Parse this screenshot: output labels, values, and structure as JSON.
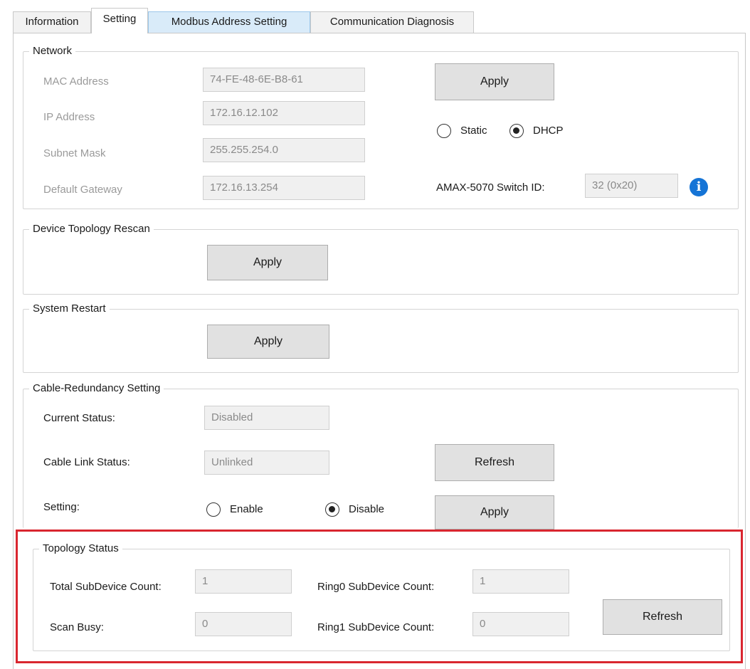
{
  "tabs": [
    {
      "label": "Information"
    },
    {
      "label": "Setting"
    },
    {
      "label": "Modbus Address Setting"
    },
    {
      "label": "Communication Diagnosis"
    }
  ],
  "network": {
    "title": "Network",
    "mac_label": "MAC Address",
    "mac_value": "74-FE-48-6E-B8-61",
    "ip_label": "IP Address",
    "ip_value": "172.16.12.102",
    "subnet_label": "Subnet Mask",
    "subnet_value": "255.255.254.0",
    "gateway_label": "Default Gateway",
    "gateway_value": "172.16.13.254",
    "apply_label": "Apply",
    "static_label": "Static",
    "dhcp_label": "DHCP",
    "mode_selected": "DHCP",
    "switch_id_label": "AMAX-5070 Switch ID:",
    "switch_id_value": "32 (0x20)",
    "info_glyph": "i"
  },
  "rescan": {
    "title": "Device Topology Rescan",
    "apply_label": "Apply"
  },
  "restart": {
    "title": "System Restart",
    "apply_label": "Apply"
  },
  "cable": {
    "title": "Cable-Redundancy Setting",
    "current_status_label": "Current Status:",
    "current_status_value": "Disabled",
    "link_status_label": "Cable Link Status:",
    "link_status_value": "Unlinked",
    "refresh_label": "Refresh",
    "setting_label": "Setting:",
    "enable_label": "Enable",
    "disable_label": "Disable",
    "setting_selected": "Disable",
    "apply_label": "Apply"
  },
  "topology": {
    "title": "Topology Status",
    "total_label": "Total SubDevice Count:",
    "total_value": "1",
    "ring0_label": "Ring0 SubDevice Count:",
    "ring0_value": "1",
    "scan_busy_label": "Scan Busy:",
    "scan_busy_value": "0",
    "ring1_label": "Ring1 SubDevice Count:",
    "ring1_value": "0",
    "refresh_label": "Refresh"
  },
  "colors": {
    "highlight": "#d9262f",
    "info_icon": "#1574d6",
    "tab_hover": "#d9ebf9"
  }
}
